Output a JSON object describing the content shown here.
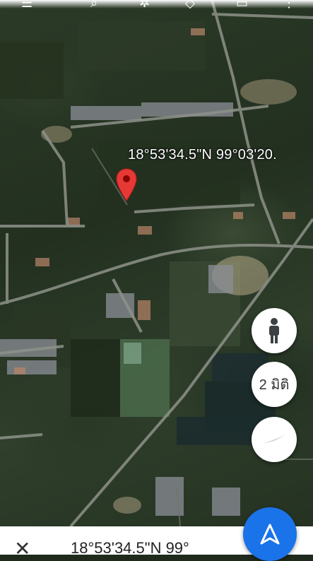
{
  "map": {
    "coordinate_label": "18°53'34.5\"N 99°03'20."
  },
  "controls": {
    "person_icon": "pegman-icon",
    "view_3d_label": "2 มิติ",
    "compass_icon": "compass-icon",
    "navigate_icon": "navigate-arrow-icon"
  },
  "bottom_bar": {
    "close_icon": "close-icon",
    "text": "18°53'34.5\"N 99°"
  },
  "colors": {
    "pin": "#e53935",
    "accent_blue": "#1a73e8"
  }
}
